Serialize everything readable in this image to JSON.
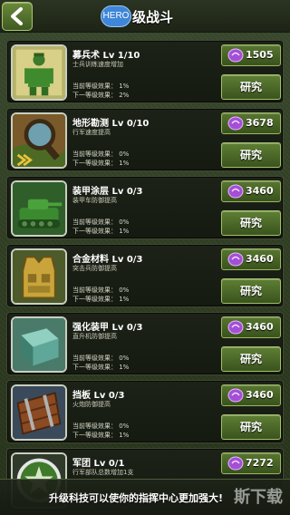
{
  "header": {
    "back_icon": "back-arrow-icon",
    "hero_badge": "HERO",
    "title": "级战斗"
  },
  "currency_icon": "purple-gem-icon",
  "upgrades": [
    {
      "name": "募兵术 Lv 1/10",
      "desc": "士兵训练速度增加",
      "current": "当前等级效果： 1%",
      "next": "下一等级效果： 2%",
      "cost": "1505",
      "action": "研究",
      "icon": "soldier-icon"
    },
    {
      "name": "地形勘测 Lv 0/10",
      "desc": "行军速度提高",
      "current": "当前等级效果： 0%",
      "next": "下一等级效果： 1%",
      "cost": "3678",
      "action": "研究",
      "icon": "magnifier-icon"
    },
    {
      "name": "装甲涂层 Lv 0/3",
      "desc": "装甲车防御提高",
      "current": "当前等级效果： 0%",
      "next": "下一等级效果： 1%",
      "cost": "3460",
      "action": "研究",
      "icon": "tank-icon"
    },
    {
      "name": "合金材料 Lv 0/3",
      "desc": "突击兵防御提高",
      "current": "当前等级效果： 0%",
      "next": "下一等级效果： 1%",
      "cost": "3460",
      "action": "研究",
      "icon": "armor-vest-icon"
    },
    {
      "name": "强化装甲 Lv 0/3",
      "desc": "直升机防御提高",
      "current": "当前等级效果： 0%",
      "next": "下一等级效果： 1%",
      "cost": "3460",
      "action": "研究",
      "icon": "steel-block-icon"
    },
    {
      "name": "挡板 Lv 0/3",
      "desc": "火炮防御提高",
      "current": "当前等级效果： 0%",
      "next": "下一等级效果： 1%",
      "cost": "3460",
      "action": "研究",
      "icon": "wooden-barrier-icon"
    },
    {
      "name": "军团 Lv 0/1",
      "desc": "行军部队总数增加1支",
      "current": "",
      "next": "",
      "cost": "7272",
      "action": "",
      "icon": "legion-emblem-icon"
    }
  ],
  "tip": "升级科技可以使你的指挥中心更加强大!",
  "watermark": "斯下载"
}
